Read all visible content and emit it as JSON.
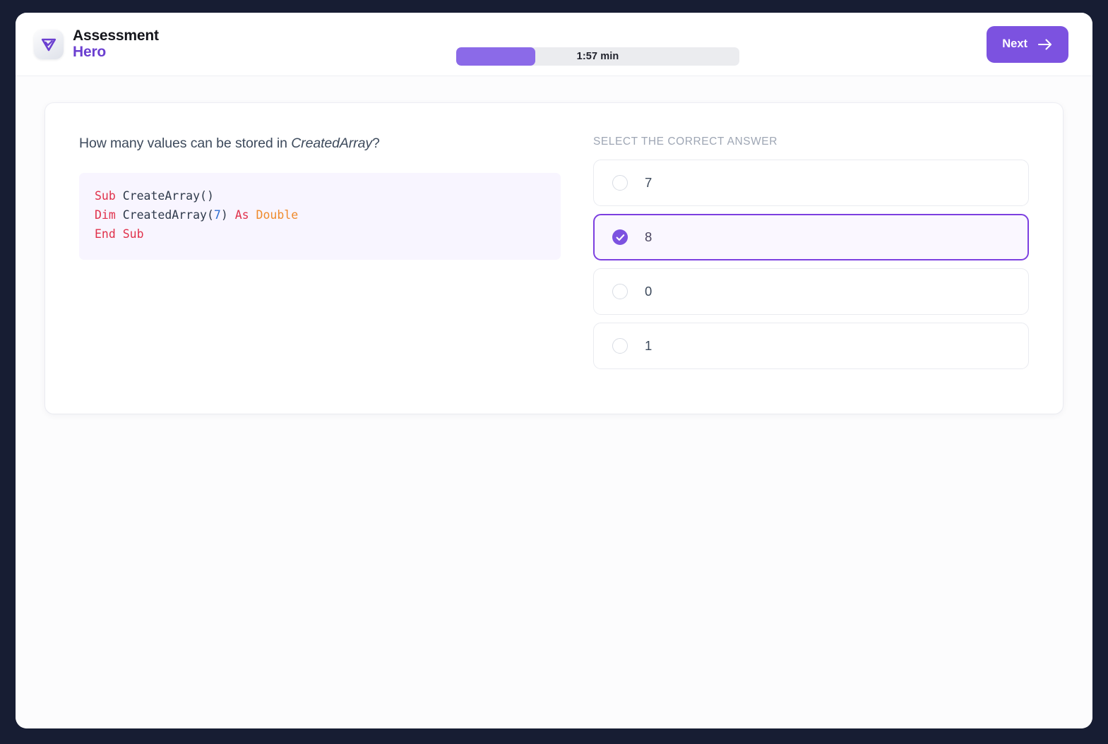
{
  "header": {
    "brand_top": "Assessment",
    "brand_bottom": "Hero",
    "logo_icon": "shield-check-icon",
    "timer_label": "1:57 min",
    "timer_progress_percent": 28,
    "next_label": "Next",
    "next_icon": "arrow-right-icon"
  },
  "question": {
    "text_before": "How many values can be stored in ",
    "emphasis": "CreatedArray",
    "text_after": "?",
    "code": {
      "language": "vba",
      "lines": [
        [
          {
            "t": "Sub",
            "c": "kw"
          },
          {
            "t": " ",
            "c": "pun"
          },
          {
            "t": "CreateArray",
            "c": "id"
          },
          {
            "t": "()",
            "c": "pun"
          }
        ],
        [
          {
            "t": "Dim",
            "c": "kw"
          },
          {
            "t": " ",
            "c": "pun"
          },
          {
            "t": "CreatedArray",
            "c": "id"
          },
          {
            "t": "(",
            "c": "pun"
          },
          {
            "t": "7",
            "c": "num"
          },
          {
            "t": ")",
            "c": "pun"
          },
          {
            "t": " ",
            "c": "pun"
          },
          {
            "t": "As",
            "c": "kw"
          },
          {
            "t": " ",
            "c": "pun"
          },
          {
            "t": "Double",
            "c": "type"
          }
        ],
        [
          {
            "t": "End",
            "c": "kw"
          },
          {
            "t": " ",
            "c": "pun"
          },
          {
            "t": "Sub",
            "c": "kw"
          }
        ]
      ],
      "plain_text": "Sub CreateArray()\nDim CreatedArray(7) As Double\nEnd Sub"
    }
  },
  "answers": {
    "label": "SELECT THE CORRECT ANSWER",
    "options": [
      {
        "label": "7",
        "selected": false
      },
      {
        "label": "8",
        "selected": true
      },
      {
        "label": "0",
        "selected": false
      },
      {
        "label": "1",
        "selected": false
      }
    ],
    "selected_value": "8",
    "check_icon": "check-icon"
  },
  "colors": {
    "accent": "#7c52e0",
    "accent_border": "#7c3fe0",
    "brand_purple": "#6b3fd0",
    "timer_fill": "#8b6ae8",
    "timer_track": "#ebecef",
    "code_bg": "#f8f5ff",
    "selected_bg": "#faf7ff",
    "frame": "#171d33",
    "text": "#3d4a5c",
    "muted": "#9ea6b4"
  }
}
